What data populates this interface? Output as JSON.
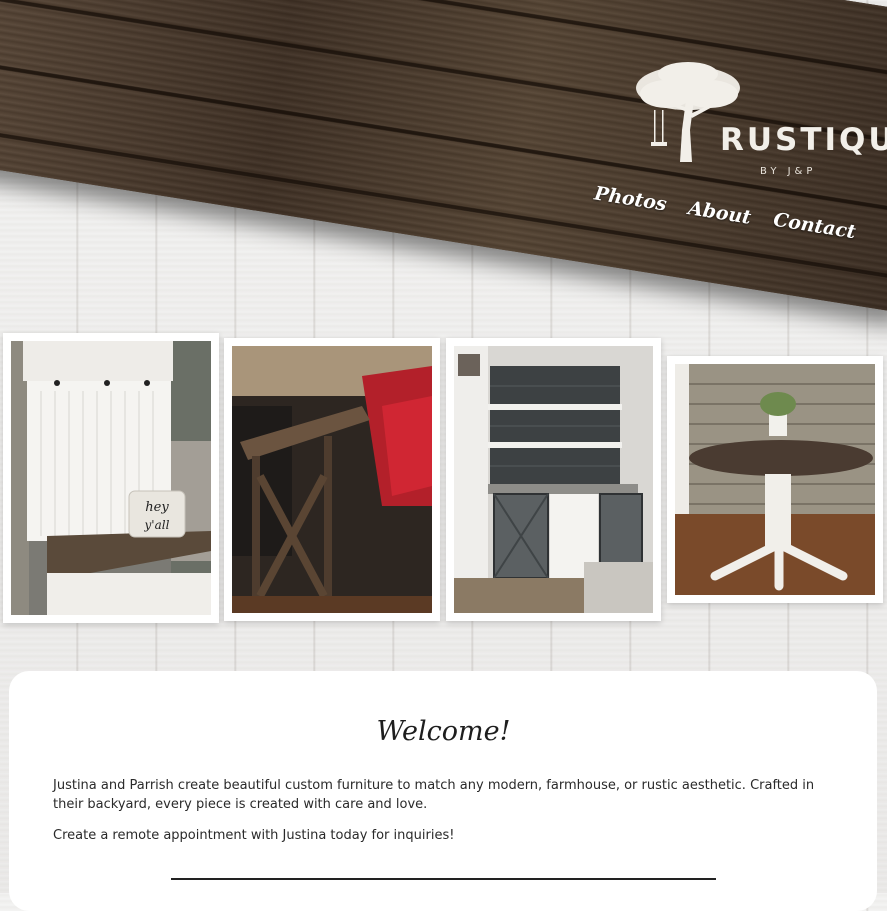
{
  "header": {
    "logo_name": "RUSTIQUE",
    "logo_by": "BY      J&P",
    "nav": [
      {
        "label": "Photos"
      },
      {
        "label": "About"
      },
      {
        "label": "Contact"
      }
    ]
  },
  "gallery": [
    {
      "subject": "white hall tree bench with coat hooks",
      "pillow_text": "hey y'all"
    },
    {
      "subject": "rustic X-frame console table with red bar stools"
    },
    {
      "subject": "kitchen wet bar with sliding barn doors"
    },
    {
      "subject": "round pedestal table with white base"
    }
  ],
  "welcome": {
    "title": "Welcome!",
    "paragraph1": "Justina and Parrish create beautiful custom furniture to match any modern, farmhouse, or rustic aesthetic. Crafted in their backyard, every piece is created with care and love.",
    "paragraph2": "Create a remote appointment with Justina today for inquiries!"
  },
  "colors": {
    "wood_dark": "#3f3024",
    "background_wood": "#f1f1f0",
    "card": "#ffffff",
    "text": "#2a2a2a"
  }
}
